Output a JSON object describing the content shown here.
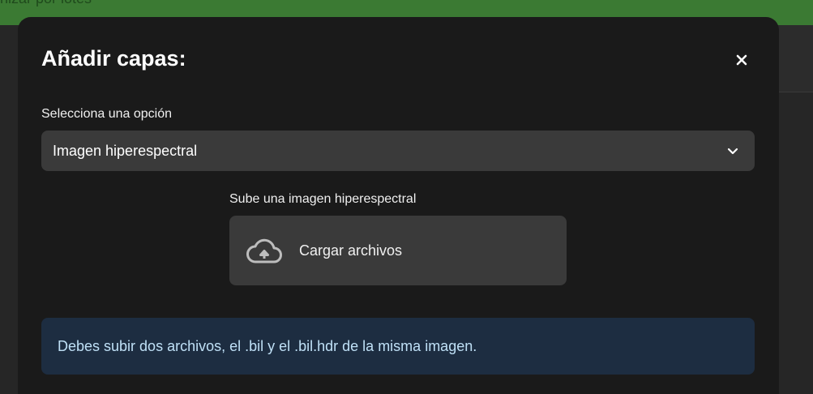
{
  "background": {
    "banner_text": "nizar por lotes",
    "banner_color": "#3b7a33"
  },
  "modal": {
    "title": "Añadir capas:",
    "close_icon": "close-icon",
    "select": {
      "label": "Selecciona una opción",
      "value": "Imagen hiperespectral",
      "icon": "chevron-down-icon"
    },
    "upload": {
      "label": "Sube una imagen hiperespectral",
      "button_text": "Cargar archivos",
      "icon": "cloud-upload-icon"
    },
    "info": {
      "text": "Debes subir dos archivos, el .bil y el .bil.hdr de la misma imagen.",
      "color": "#1d2d41"
    }
  }
}
